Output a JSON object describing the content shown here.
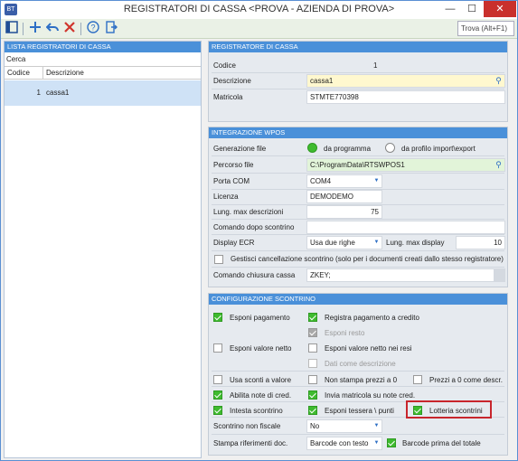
{
  "window": {
    "title": "REGISTRATORI DI CASSA <PROVA - AZIENDA DI PROVA>",
    "app_icon": "BT",
    "min": "—",
    "max": "☐",
    "close": "✕"
  },
  "toolbar": {
    "search_label": "Trova (Alt+F1)"
  },
  "left": {
    "header": "LISTA REGISTRATORI DI CASSA",
    "cerca": "Cerca",
    "col_codice": "Codice",
    "col_descrizione": "Descrizione",
    "rows": [
      {
        "codice": "1",
        "descrizione": "cassa1"
      }
    ]
  },
  "reg": {
    "header": "REGISTRATORE DI CASSA",
    "codice_label": "Codice",
    "codice_value": "1",
    "descrizione_label": "Descrizione",
    "descrizione_value": "cassa1",
    "matricola_label": "Matricola",
    "matricola_value": "STMTE770398"
  },
  "wpos": {
    "header": "INTEGRAZIONE WPOS",
    "gen_label": "Generazione file",
    "gen_opt1": "da programma",
    "gen_opt2": "da profilo import\\export",
    "percorso_label": "Percorso file",
    "percorso_value": "C:\\ProgramData\\RTSWPOS1",
    "porta_label": "Porta COM",
    "porta_value": "COM4",
    "licenza_label": "Licenza",
    "licenza_value": "DEMODEMO",
    "lung_label": "Lung. max descrizioni",
    "lung_value": "75",
    "comando_label": "Comando dopo scontrino",
    "comando_value": "",
    "display_label": "Display ECR",
    "display_value": "Usa due righe",
    "lung_disp_label": "Lung. max display",
    "lung_disp_value": "10",
    "gestisci_label": "Gestisci cancellazione scontrino (solo per i documenti creati dallo stesso registratore)",
    "chiusura_label": "Comando chiusura cassa",
    "chiusura_value": "ZKEY;"
  },
  "conf": {
    "header": "CONFIGURAZIONE SCONTRINO",
    "esponi_pagamento": "Esponi pagamento",
    "registra_pagamento": "Registra pagamento a credito",
    "esponi_resto": "Esponi resto",
    "esponi_valore_netto": "Esponi valore netto",
    "esponi_valore_netto_resi": "Esponi valore netto nei resi",
    "dati_descrizione": "Dati come descrizione",
    "usa_sconti": "Usa sconti a valore",
    "non_stampa": "Non stampa prezzi a 0",
    "prezzi_zero": "Prezzi a 0 come descr.",
    "abilita_note": "Abilita note di cred.",
    "invia_matricola": "Invia matricola su note cred.",
    "intesta": "Intesta scontrino",
    "esponi_tessera": "Esponi tessera \\ punti",
    "lotteria": "Lotteria scontrini",
    "non_fiscale_label": "Scontrino non fiscale",
    "non_fiscale_value": "No",
    "stampa_rif_label": "Stampa riferimenti doc.",
    "stampa_rif_value": "Barcode con testo",
    "barcode_prima": "Barcode prima del totale"
  },
  "colors": {
    "accent": "#4a90d9",
    "check": "#3fbb2f",
    "highlight": "#c8252c"
  }
}
